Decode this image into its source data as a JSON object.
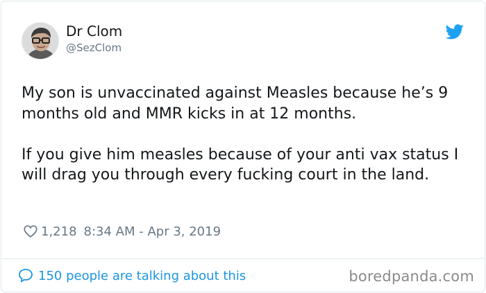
{
  "user": {
    "display_name": "Dr Clom",
    "handle": "@SezClom"
  },
  "tweet": {
    "paragraphs": [
      "My son is unvaccinated against Measles because he’s 9 months old and MMR kicks in at 12 months.",
      "If you give him measles because of your anti vax status I will drag you through every fucking court in the land."
    ],
    "likes": "1,218",
    "timestamp": "8:34 AM - Apr 3, 2019"
  },
  "footer": {
    "talking_label": "150 people are talking about this"
  },
  "watermark": "boredpanda.com",
  "colors": {
    "text": "#14171a",
    "muted": "#657786",
    "twitter_blue": "#1da1f2",
    "link_blue": "#1b95e0",
    "border": "#e1e8ed"
  },
  "icons": [
    "avatar",
    "twitter-bird-icon",
    "heart-icon",
    "speech-bubble-icon"
  ]
}
